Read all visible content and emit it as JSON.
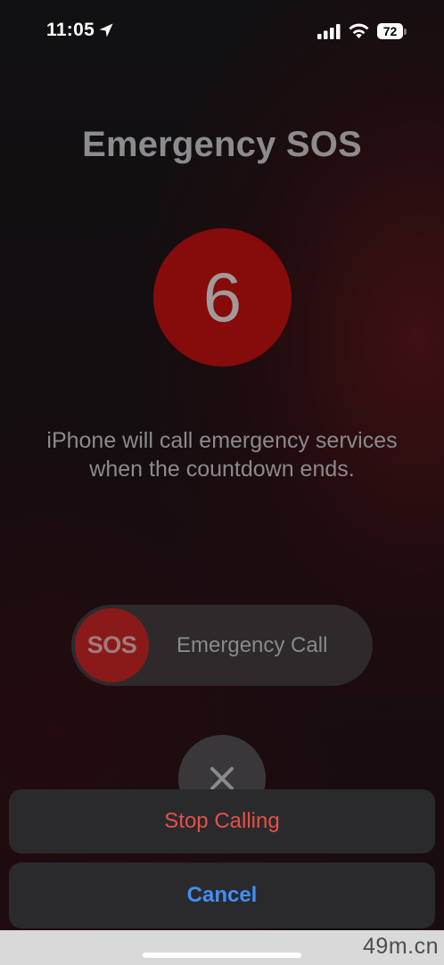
{
  "status_bar": {
    "time": "11:05",
    "battery_level": "72",
    "icons": [
      "location-arrow-icon",
      "cellular-signal-icon",
      "wifi-icon",
      "battery-icon"
    ]
  },
  "title": "Emergency SOS",
  "countdown": {
    "value": "6",
    "color": "#860b0b"
  },
  "description": {
    "line1": "iPhone will call emergency services",
    "line2": "when the countdown ends."
  },
  "slider": {
    "knob_label": "SOS",
    "label": "Emergency Call",
    "knob_color": "#8a1a1a"
  },
  "dismiss": {
    "icon": "close-icon"
  },
  "action_sheet": {
    "stop_label": "Stop Calling",
    "cancel_label": "Cancel",
    "stop_color": "#e5504a",
    "cancel_color": "#3f8ff5"
  },
  "watermark": "49m.cn"
}
